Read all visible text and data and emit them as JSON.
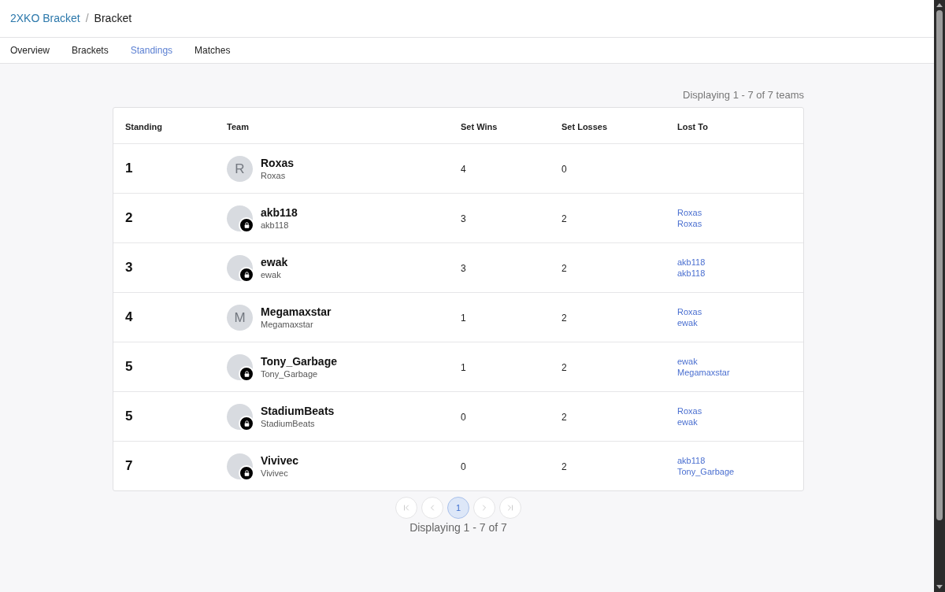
{
  "breadcrumb": {
    "link": "2XKO Bracket",
    "separator": "/",
    "current": "Bracket"
  },
  "tabs": [
    {
      "label": "Overview",
      "selected": false
    },
    {
      "label": "Brackets",
      "selected": false
    },
    {
      "label": "Standings",
      "selected": true
    },
    {
      "label": "Matches",
      "selected": false
    }
  ],
  "results_count": "Displaying 1 - 7 of 7 teams",
  "table": {
    "columns": [
      "Standing",
      "Team",
      "Set Wins",
      "Set Losses",
      "Lost To"
    ],
    "rows": [
      {
        "standing": "1",
        "team": {
          "name": "Roxas",
          "handle": "Roxas",
          "avatar_initial": "R",
          "locked": false
        },
        "set_wins": "4",
        "set_losses": "0"
      },
      {
        "standing": "2",
        "team": {
          "name": "akb118",
          "handle": "akb118",
          "locked": true
        },
        "set_wins": "3",
        "set_losses": "2",
        "lost_to": [
          "Roxas",
          "Roxas"
        ]
      },
      {
        "standing": "3",
        "team": {
          "name": "ewak",
          "handle": "ewak",
          "locked": true
        },
        "set_wins": "3",
        "set_losses": "2",
        "lost_to": [
          "akb118",
          "akb118"
        ]
      },
      {
        "standing": "4",
        "team": {
          "name": "Megamaxstar",
          "handle": "Megamaxstar",
          "avatar_initial": "M",
          "locked": false
        },
        "set_wins": "1",
        "set_losses": "2",
        "lost_to": [
          "Roxas",
          "ewak"
        ]
      },
      {
        "standing": "5",
        "team": {
          "name": "Tony_Garbage",
          "handle": "Tony_Garbage",
          "locked": true
        },
        "set_wins": "1",
        "set_losses": "2",
        "lost_to": [
          "ewak",
          "Megamaxstar"
        ]
      },
      {
        "standing": "5",
        "team": {
          "name": "StadiumBeats",
          "handle": "StadiumBeats",
          "locked": true
        },
        "set_wins": "0",
        "set_losses": "2",
        "lost_to": [
          "Roxas",
          "ewak"
        ]
      },
      {
        "standing": "7",
        "team": {
          "name": "Vivivec",
          "handle": "Vivivec",
          "locked": true
        },
        "set_wins": "0",
        "set_losses": "2",
        "lost_to": [
          "akb118",
          "Tony_Garbage"
        ]
      }
    ]
  },
  "pagination": {
    "first": {
      "disabled": true
    },
    "previous": {
      "disabled": true
    },
    "pages": [
      {
        "label": "1",
        "selected": true
      }
    ],
    "next": {
      "disabled": true
    },
    "last": {
      "disabled": true
    },
    "summary": "Displaying 1 - 7 of 7"
  }
}
